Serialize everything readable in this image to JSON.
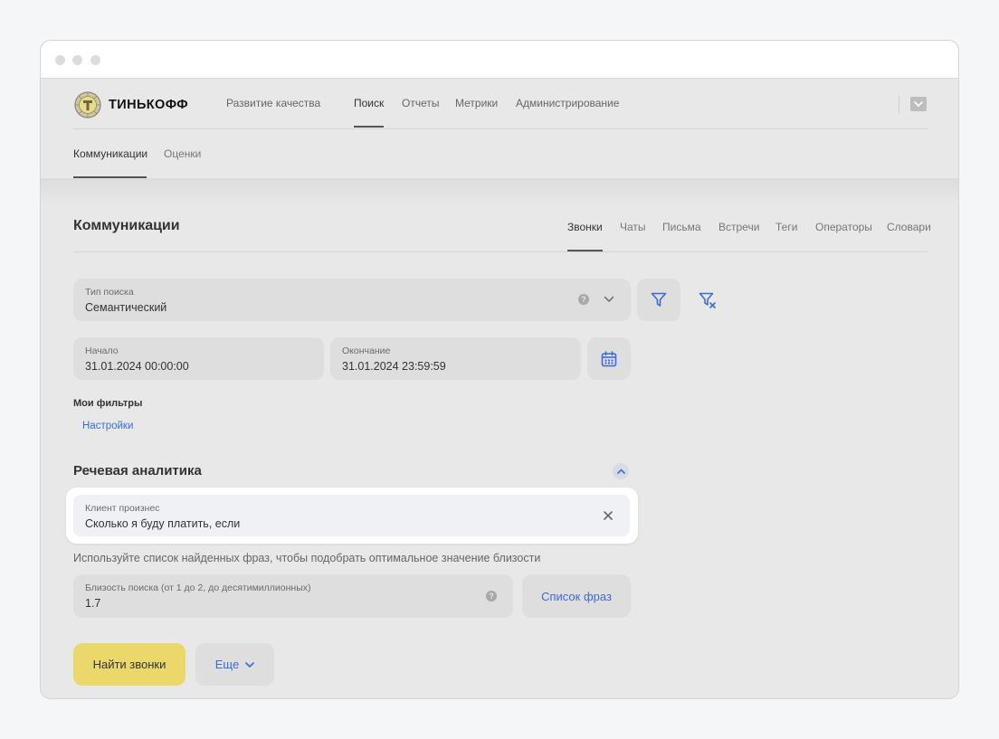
{
  "logo": {
    "text": "ТИНЬКОФФ"
  },
  "topnav": {
    "items": [
      {
        "label": "Развитие качества"
      },
      {
        "label": "Поиск"
      },
      {
        "label": "Отчеты"
      },
      {
        "label": "Метрики"
      },
      {
        "label": "Администрирование"
      }
    ],
    "active": "Поиск"
  },
  "subnav": {
    "items": [
      {
        "label": "Коммуникации"
      },
      {
        "label": "Оценки"
      }
    ],
    "active": "Коммуникации"
  },
  "page": {
    "title": "Коммуникации",
    "tabs": [
      {
        "label": "Звонки"
      },
      {
        "label": "Чаты"
      },
      {
        "label": "Письма"
      },
      {
        "label": "Встречи"
      },
      {
        "label": "Теги"
      },
      {
        "label": "Операторы"
      },
      {
        "label": "Словари"
      }
    ],
    "active_tab": "Звонки"
  },
  "search_type": {
    "label": "Тип поиска",
    "value": "Семантический",
    "help_glyph": "?"
  },
  "date_range": {
    "start_label": "Начало",
    "start_value": "31.01.2024 00:00:00",
    "end_label": "Окончание",
    "end_value": "31.01.2024 23:59:59"
  },
  "my_filters": {
    "title": "Мои фильтры",
    "settings_link": "Настройки"
  },
  "speech_analytics": {
    "title": "Речевая аналитика",
    "phrase_field": {
      "label": "Клиент произнес",
      "value": "Сколько я буду платить, если"
    },
    "hint": "Используйте список найденных фраз, чтобы подобрать оптимальное значение близости",
    "proximity": {
      "label": "Близость поиска (от 1 до 2, до десятимиллионных)",
      "value": "1.7",
      "help_glyph": "?"
    },
    "phrase_list_button": "Список фраз"
  },
  "actions": {
    "find_button": "Найти звонки",
    "more_button": "Еще"
  },
  "colors": {
    "accent_link": "#3a6bd6",
    "primary_button": "#ead86a",
    "field_bg": "#dedede",
    "page_bg": "#e8e8e8"
  }
}
